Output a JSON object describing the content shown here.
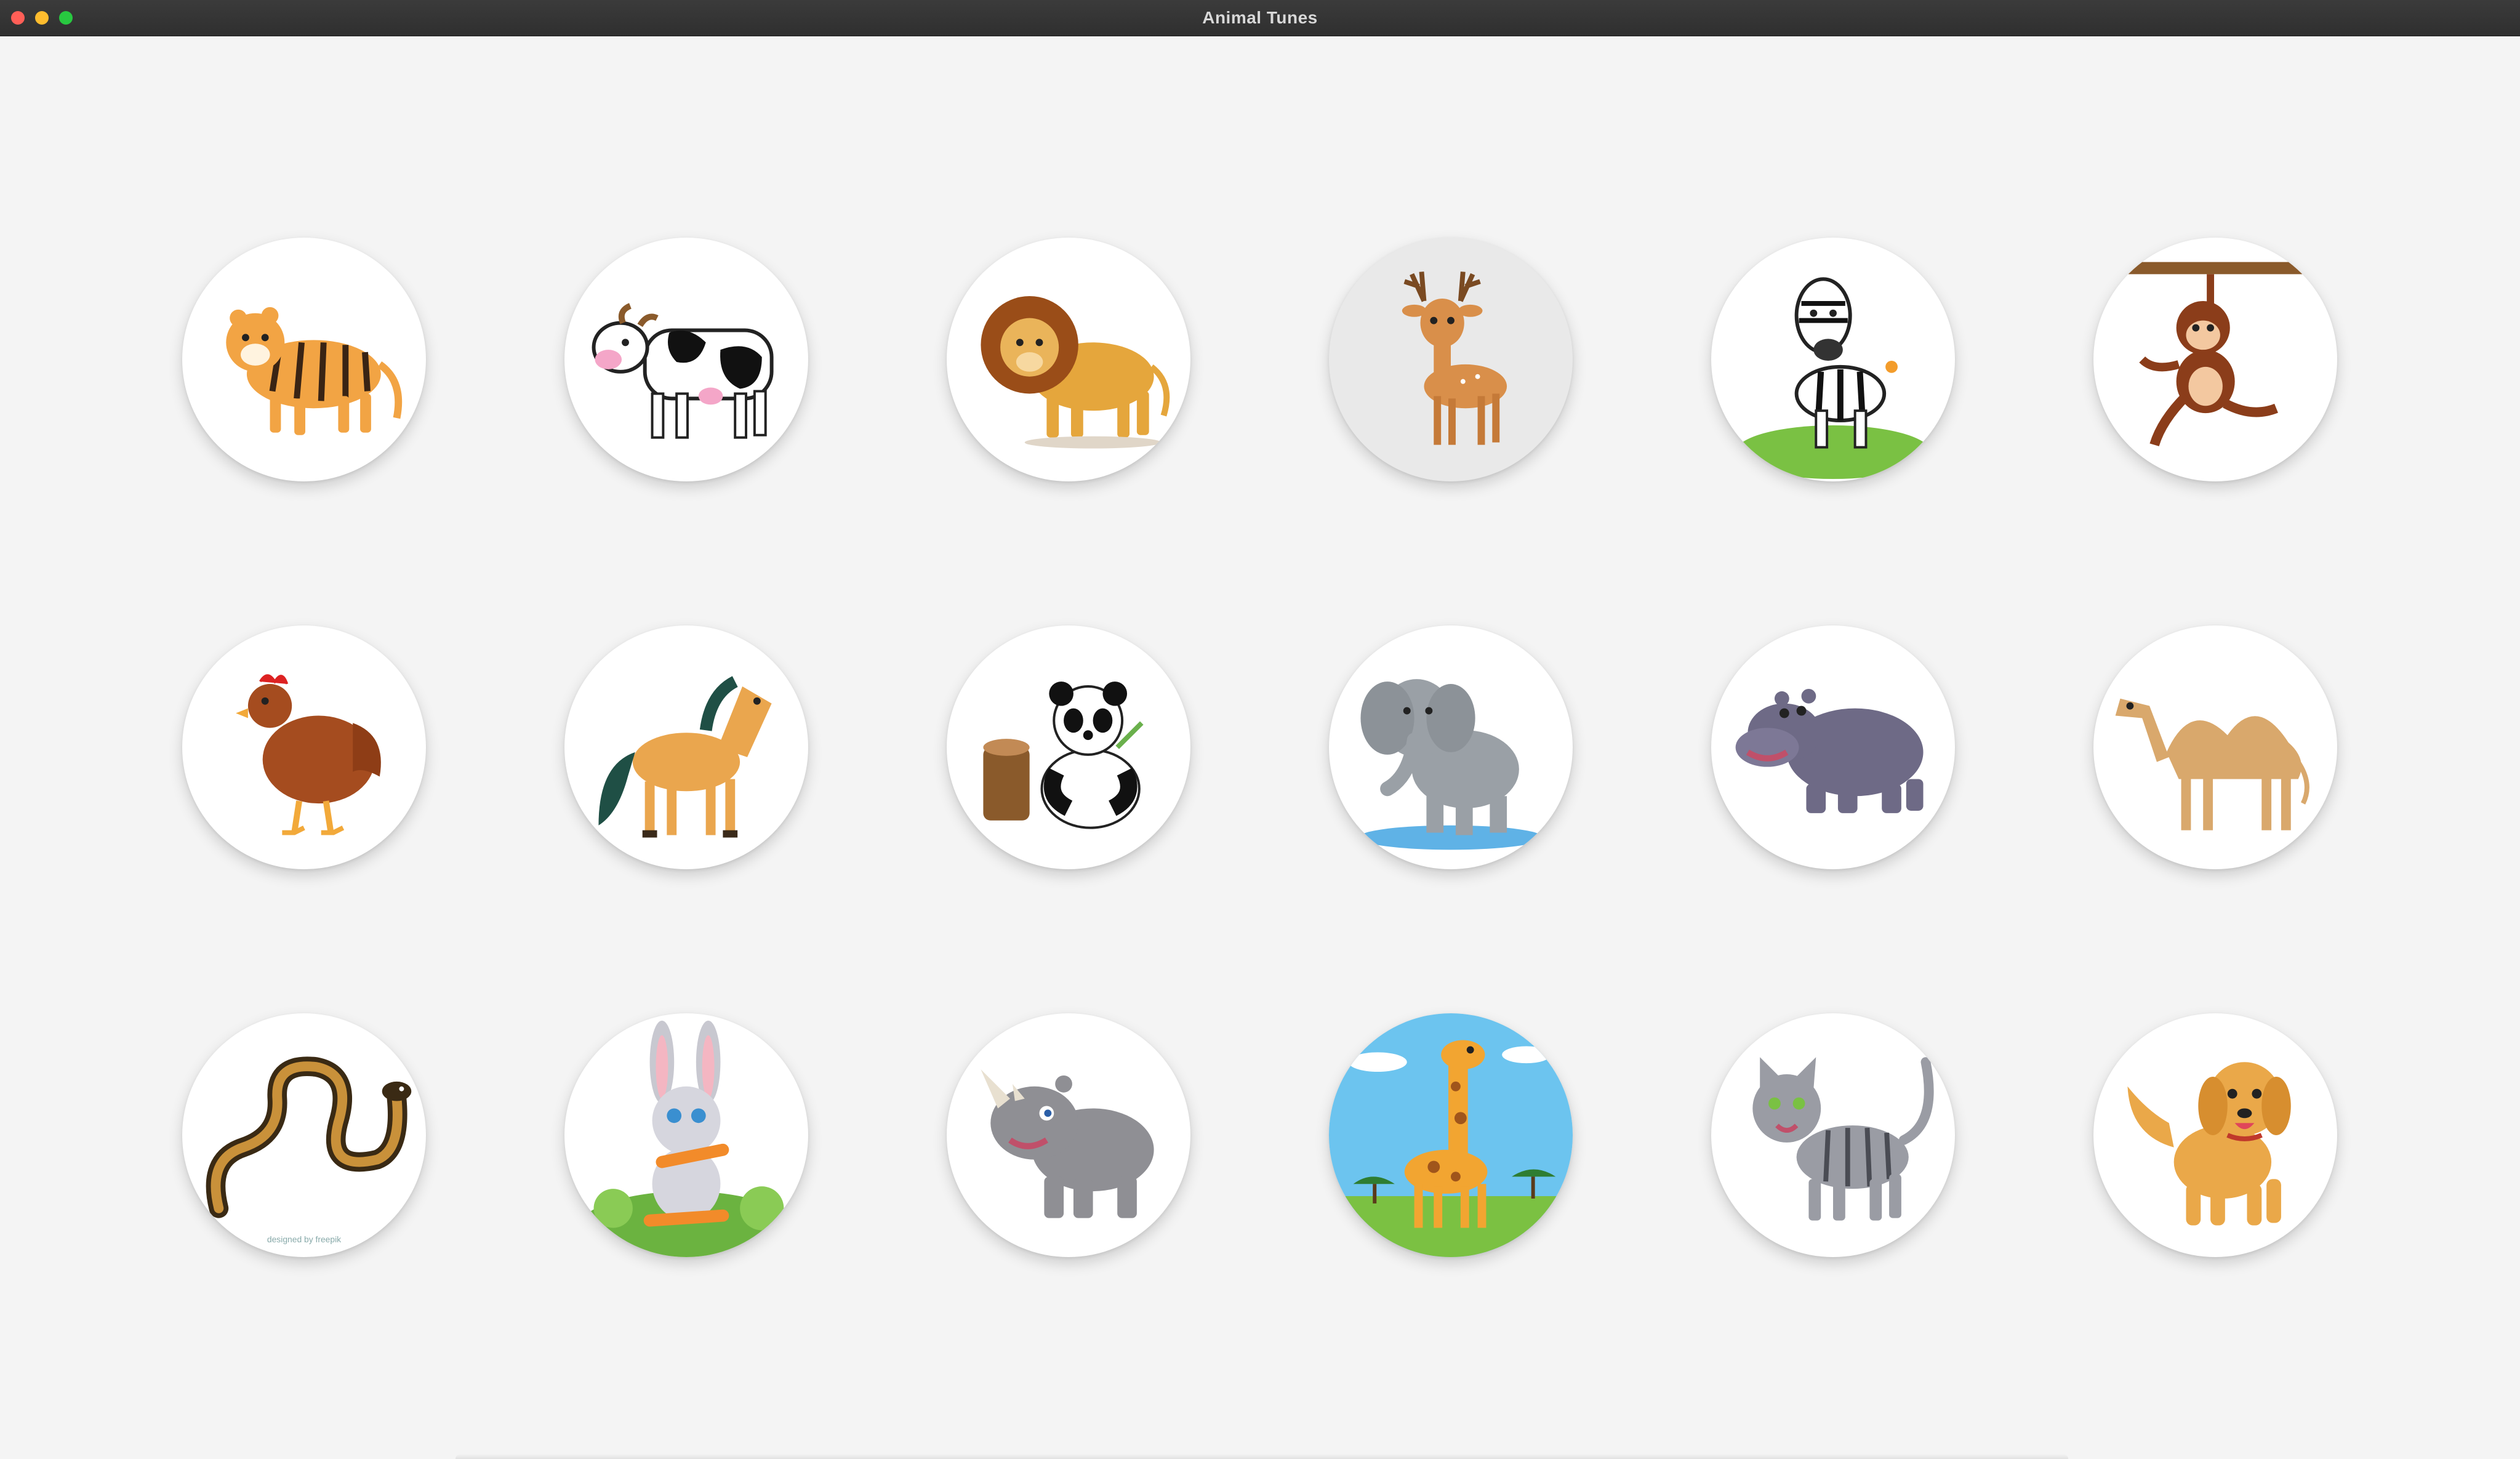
{
  "window": {
    "title": "Animal Tunes",
    "controls": [
      "close",
      "minimize",
      "maximize"
    ]
  },
  "animals": [
    {
      "name": "tiger",
      "icon": "tiger-icon"
    },
    {
      "name": "cow",
      "icon": "cow-icon"
    },
    {
      "name": "lion",
      "icon": "lion-icon"
    },
    {
      "name": "deer",
      "icon": "deer-icon",
      "state": "hover"
    },
    {
      "name": "zebra",
      "icon": "zebra-icon"
    },
    {
      "name": "monkey",
      "icon": "monkey-icon"
    },
    {
      "name": "hen",
      "icon": "hen-icon"
    },
    {
      "name": "horse",
      "icon": "horse-icon"
    },
    {
      "name": "panda",
      "icon": "panda-icon"
    },
    {
      "name": "elephant",
      "icon": "elephant-icon"
    },
    {
      "name": "hippo",
      "icon": "hippo-icon"
    },
    {
      "name": "camel",
      "icon": "camel-icon"
    },
    {
      "name": "snake",
      "icon": "snake-icon",
      "credit": "designed by freepik"
    },
    {
      "name": "rabbit",
      "icon": "rabbit-icon"
    },
    {
      "name": "rhino",
      "icon": "rhino-icon"
    },
    {
      "name": "giraffe",
      "icon": "giraffe-icon"
    },
    {
      "name": "cat",
      "icon": "cat-icon"
    },
    {
      "name": "dog",
      "icon": "dog-icon"
    }
  ],
  "colors": {
    "background": "#f4f4f4",
    "titlebar": "#333333",
    "tile": "#ffffff",
    "tile_hover": "#e9e9e9"
  }
}
